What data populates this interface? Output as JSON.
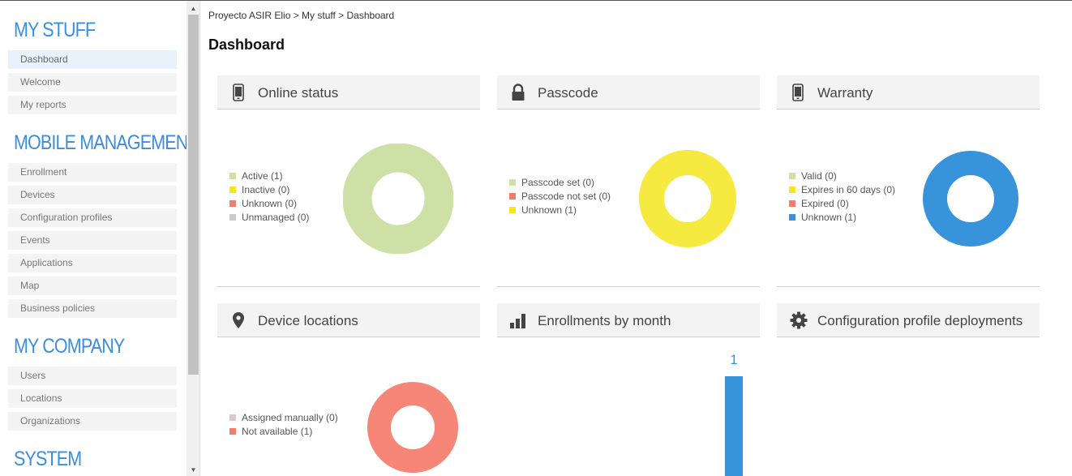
{
  "breadcrumb": "Proyecto ASIR Elio > My stuff > Dashboard",
  "page_title": "Dashboard",
  "sidebar": {
    "sections": [
      {
        "title": "MY STUFF",
        "items": [
          "Dashboard",
          "Welcome",
          "My reports"
        ]
      },
      {
        "title": "MOBILE MANAGEMENT",
        "items": [
          "Enrollment",
          "Devices",
          "Configuration profiles",
          "Events",
          "Applications",
          "Map",
          "Business policies"
        ]
      },
      {
        "title": "MY COMPANY",
        "items": [
          "Users",
          "Locations",
          "Organizations"
        ]
      },
      {
        "title": "SYSTEM",
        "items": []
      }
    ],
    "active_item": "Dashboard"
  },
  "widgets": {
    "online_status": {
      "title": "Online status",
      "icon": "phone-icon",
      "legend": [
        {
          "label": "Active (1)",
          "color": "#cde1a7",
          "value": 1
        },
        {
          "label": "Inactive (0)",
          "color": "#f5e51e",
          "value": 0
        },
        {
          "label": "Unknown (0)",
          "color": "#f47c6c",
          "value": 0
        },
        {
          "label": "Unmanaged (0)",
          "color": "#cccccc",
          "value": 0
        }
      ]
    },
    "passcode": {
      "title": "Passcode",
      "icon": "lock-icon",
      "legend": [
        {
          "label": "Passcode set (0)",
          "color": "#cde1a7",
          "value": 0
        },
        {
          "label": "Passcode not set (0)",
          "color": "#f47c6c",
          "value": 0
        },
        {
          "label": "Unknown (1)",
          "color": "#f5e51e",
          "value": 1
        }
      ]
    },
    "warranty": {
      "title": "Warranty",
      "icon": "phone-icon",
      "legend": [
        {
          "label": "Valid (0)",
          "color": "#cde1a7",
          "value": 0
        },
        {
          "label": "Expires in 60 days (0)",
          "color": "#f5e51e",
          "value": 0
        },
        {
          "label": "Expired (0)",
          "color": "#f47c6c",
          "value": 0
        },
        {
          "label": "Unknown (1)",
          "color": "#3794db",
          "value": 1
        }
      ]
    },
    "device_locations": {
      "title": "Device locations",
      "icon": "map-pin-icon",
      "legend": [
        {
          "label": "Assigned manually (0)",
          "color": "#dcc6cf",
          "value": 0
        },
        {
          "label": "Not available (1)",
          "color": "#f47c6c",
          "value": 1
        }
      ]
    },
    "enrollments_by_month": {
      "title": "Enrollments by month",
      "icon": "bar-chart-icon",
      "bar_label": "1",
      "bar_color": "#3794db"
    },
    "config_profile_deployments": {
      "title": "Configuration profile deployments",
      "icon": "gear-icon"
    }
  },
  "chart_data": [
    {
      "type": "pie",
      "title": "Online status",
      "categories": [
        "Active",
        "Inactive",
        "Unknown",
        "Unmanaged"
      ],
      "values": [
        1,
        0,
        0,
        0
      ]
    },
    {
      "type": "pie",
      "title": "Passcode",
      "categories": [
        "Passcode set",
        "Passcode not set",
        "Unknown"
      ],
      "values": [
        0,
        0,
        1
      ]
    },
    {
      "type": "pie",
      "title": "Warranty",
      "categories": [
        "Valid",
        "Expires in 60 days",
        "Expired",
        "Unknown"
      ],
      "values": [
        0,
        0,
        0,
        1
      ]
    },
    {
      "type": "pie",
      "title": "Device locations",
      "categories": [
        "Assigned manually",
        "Not available"
      ],
      "values": [
        0,
        1
      ]
    },
    {
      "type": "bar",
      "title": "Enrollments by month",
      "values": [
        1
      ]
    }
  ]
}
